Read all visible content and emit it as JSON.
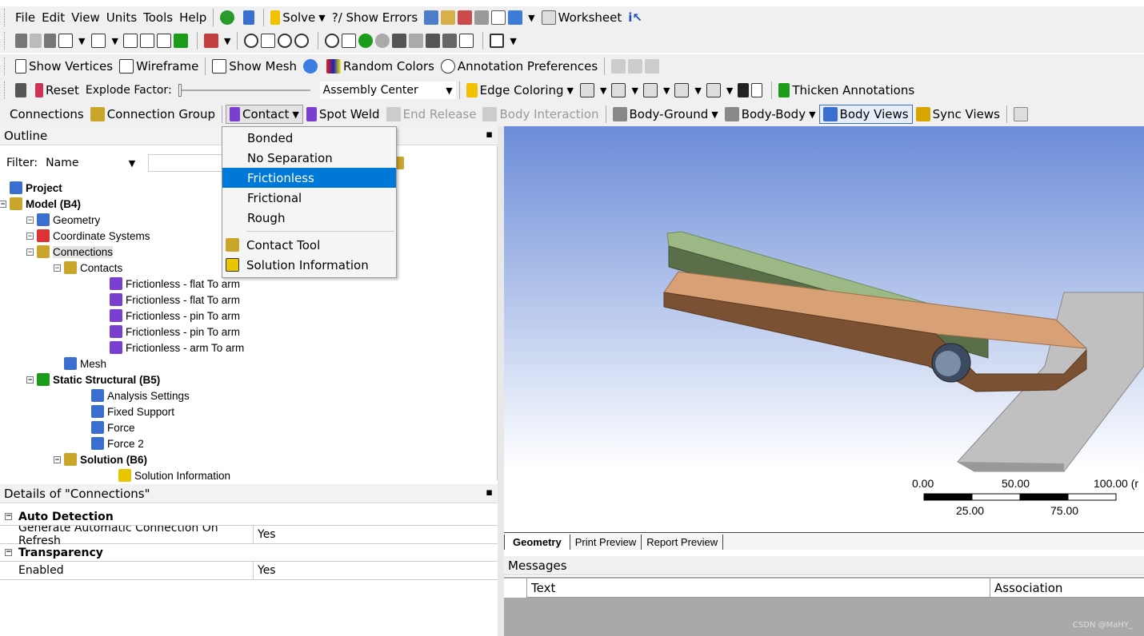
{
  "menubar": {
    "items": [
      "File",
      "Edit",
      "View",
      "Units",
      "Tools",
      "Help"
    ],
    "solve": "Solve",
    "show_errors": "?/ Show Errors",
    "worksheet": "Worksheet"
  },
  "toolbar3": {
    "show_vertices": "Show Vertices",
    "wireframe": "Wireframe",
    "show_mesh": "Show Mesh",
    "random_colors": "Random Colors",
    "annotation_prefs": "Annotation Preferences"
  },
  "toolbar4": {
    "reset": "Reset",
    "explode_factor": "Explode Factor:",
    "assembly_center": "Assembly Center",
    "edge_coloring": "Edge Coloring",
    "thicken_annotations": "Thicken Annotations"
  },
  "toolbar5": {
    "connections": "Connections",
    "connection_group": "Connection Group",
    "contact": "Contact",
    "spot_weld": "Spot Weld",
    "end_release": "End Release",
    "body_interaction": "Body Interaction",
    "body_ground": "Body-Ground",
    "body_body": "Body-Body",
    "body_views": "Body Views",
    "sync_views": "Sync Views"
  },
  "outline": {
    "title": "Outline",
    "filter_label": "Filter:",
    "filter_value": "Name",
    "tree": [
      {
        "label": "Project",
        "bold": true
      },
      {
        "label": "Model (B4)",
        "bold": true
      },
      {
        "label": "Geometry"
      },
      {
        "label": "Coordinate Systems"
      },
      {
        "label": "Connections"
      },
      {
        "label": "Contacts"
      },
      {
        "label": "Frictionless - flat To arm"
      },
      {
        "label": "Frictionless - flat To arm"
      },
      {
        "label": "Frictionless - pin To arm"
      },
      {
        "label": "Frictionless - pin To arm"
      },
      {
        "label": "Frictionless - arm To arm"
      },
      {
        "label": "Mesh"
      },
      {
        "label": "Static Structural (B5)",
        "bold": true
      },
      {
        "label": "Analysis Settings"
      },
      {
        "label": "Fixed Support"
      },
      {
        "label": "Force"
      },
      {
        "label": "Force 2"
      },
      {
        "label": "Solution (B6)",
        "bold": true
      },
      {
        "label": "Solution Information"
      }
    ]
  },
  "contact_menu": {
    "items": [
      "Bonded",
      "No Separation",
      "Frictionless",
      "Frictional",
      "Rough"
    ],
    "selected": "Frictionless",
    "tools": [
      "Contact Tool",
      "Solution Information"
    ]
  },
  "details": {
    "title": "Details of \"Connections\"",
    "groups": [
      {
        "name": "Auto Detection",
        "rows": [
          {
            "k": "Generate Automatic Connection On Refresh",
            "v": "Yes"
          }
        ]
      },
      {
        "name": "Transparency",
        "rows": [
          {
            "k": "Enabled",
            "v": "Yes"
          }
        ]
      }
    ]
  },
  "viewport": {
    "scale_top": [
      "0.00",
      "50.00",
      "100.00 (r"
    ],
    "scale_bottom": [
      "25.00",
      "75.00"
    ],
    "tabs": [
      "Geometry",
      "Print Preview",
      "Report Preview"
    ]
  },
  "messages": {
    "title": "Messages",
    "columns": [
      "Text",
      "Association"
    ],
    "watermark": "CSDN @MaHY_"
  },
  "colors": {
    "selection": "#0078d7",
    "viewport_top": "#6c8dd9",
    "viewport_bottom": "#ffffff"
  }
}
